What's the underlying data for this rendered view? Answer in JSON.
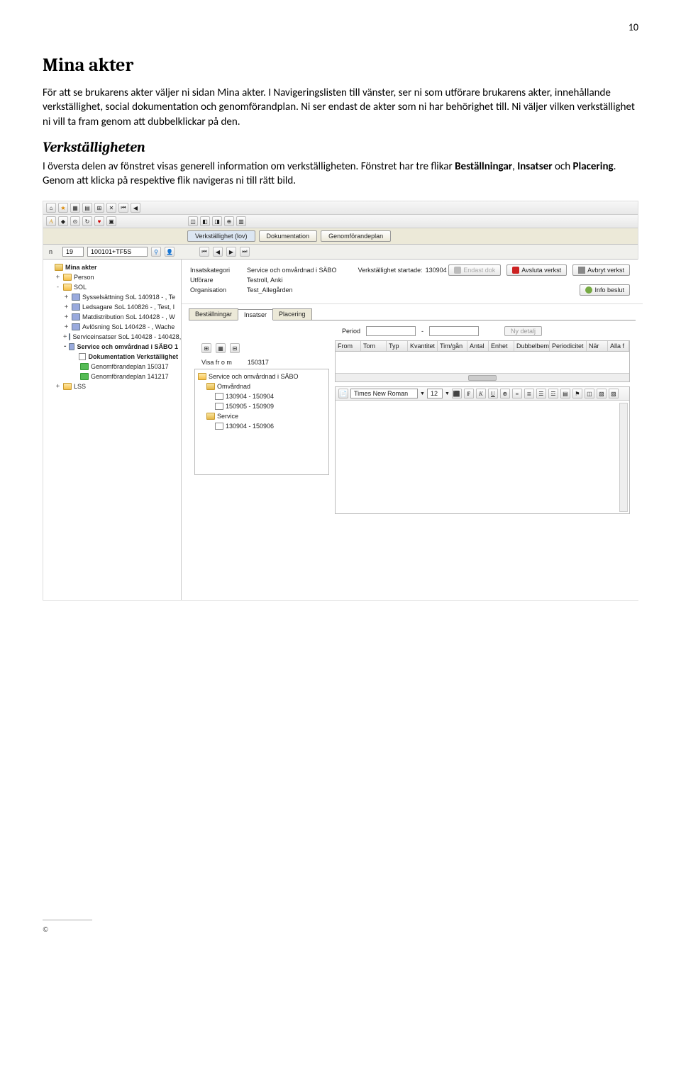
{
  "page_number": "10",
  "heading1": "Mina akter",
  "para1": "För att se brukarens akter väljer ni sidan Mina akter. I Navigeringslisten till vänster, ser ni som utförare brukarens akter, innehållande verkställighet, social dokumentation och genomförandplan. Ni ser endast de akter som ni har behörighet till. Ni väljer vilken verkställighet ni vill ta fram genom att dubbelklickar på den.",
  "heading2": "Verkställigheten",
  "para2a": "I översta delen av fönstret visas generell information om verkställigheten. Fönstret har tre flikar ",
  "para2b_bold1": "Beställningar",
  "para2b_sep1": ", ",
  "para2b_bold2": "Insatser",
  "para2b_sep2": " och ",
  "para2b_bold3": "Placering",
  "para2c": ". Genom att klicka på respektive flik navigeras ni till rätt bild.",
  "top_input_left": "19",
  "top_input_code": "100101+TF5S",
  "main_tabs": [
    "Verkställighet (lov)",
    "Dokumentation",
    "Genomförandeplan"
  ],
  "sidebar": [
    {
      "exp": "",
      "icon": "fldc",
      "label": "Mina akter",
      "indent": 0,
      "bold": true
    },
    {
      "exp": "+",
      "icon": "fld",
      "label": "Person",
      "indent": 1
    },
    {
      "exp": "-",
      "icon": "fld",
      "label": "SOL",
      "indent": 1
    },
    {
      "exp": "+",
      "icon": "node",
      "label": "Sysselsättning SoL 140918 - , Te",
      "indent": 2
    },
    {
      "exp": "+",
      "icon": "node",
      "label": "Ledsagare SoL 140826 - , Test, I",
      "indent": 2
    },
    {
      "exp": "+",
      "icon": "node",
      "label": "Matdistribution SoL 140428 - , W",
      "indent": 2
    },
    {
      "exp": "+",
      "icon": "node",
      "label": "Avlösning SoL 140428 - , Wache",
      "indent": 2
    },
    {
      "exp": "+",
      "icon": "node",
      "label": "Serviceinsatser SoL 140428 - 140428, ",
      "indent": 2
    },
    {
      "exp": "-",
      "icon": "node",
      "label": "Service och omvårdnad i SÄBO 1",
      "indent": 2,
      "bold": true
    },
    {
      "exp": "",
      "icon": "doc",
      "label": "Dokumentation Verkställighet",
      "indent": 3,
      "bold": true
    },
    {
      "exp": "",
      "icon": "grn",
      "label": "Genomförandeplan 150317",
      "indent": 3
    },
    {
      "exp": "",
      "icon": "grn",
      "label": "Genomförandeplan 141217",
      "indent": 3
    },
    {
      "exp": "+",
      "icon": "fld",
      "label": "LSS",
      "indent": 1
    }
  ],
  "info": {
    "insatskategori_lbl": "Insatskategori",
    "insatskategori_val": "Service och omvårdnad i SÄBO",
    "utforare_lbl": "Utförare",
    "utforare_val": "Testroll, Anki",
    "organisation_lbl": "Organisation",
    "organisation_val": "Test_Allegården",
    "startade_lbl": "Verkställighet startade:",
    "startade_val": "130904"
  },
  "right_buttons": {
    "endast_dok": "Endast dok",
    "avsluta": "Avsluta verkst",
    "avbryt": "Avbryt verkst",
    "info_beslut": "Info beslut"
  },
  "mini_tabs": [
    "Beställningar",
    "Insatser",
    "Placering"
  ],
  "period_label": "Period",
  "ny_detalj": "Ny detalj",
  "visa_from_lbl": "Visa fr o m",
  "visa_from_val": "150317",
  "inner_tree": [
    {
      "icon": "fld",
      "label": "Service och omvårdnad i SÄBO",
      "indent": 0
    },
    {
      "icon": "fldc",
      "label": "Omvårdnad",
      "indent": 1
    },
    {
      "icon": "doc",
      "label": "130904 - 150904",
      "indent": 2
    },
    {
      "icon": "doc",
      "label": "150905 - 150909",
      "indent": 2
    },
    {
      "icon": "fldc",
      "label": "Service",
      "indent": 1
    },
    {
      "icon": "doc",
      "label": "130904 - 150906",
      "indent": 2
    }
  ],
  "grid_headers": [
    "From",
    "Tom",
    "Typ",
    "Kvantitet",
    "Tim/gån",
    "Antal",
    "Enhet",
    "Dubbelbem",
    "Periodicitet",
    "När",
    "Alla f"
  ],
  "rtf": {
    "font": "Times New Roman",
    "size": "12"
  },
  "copyright": "©"
}
